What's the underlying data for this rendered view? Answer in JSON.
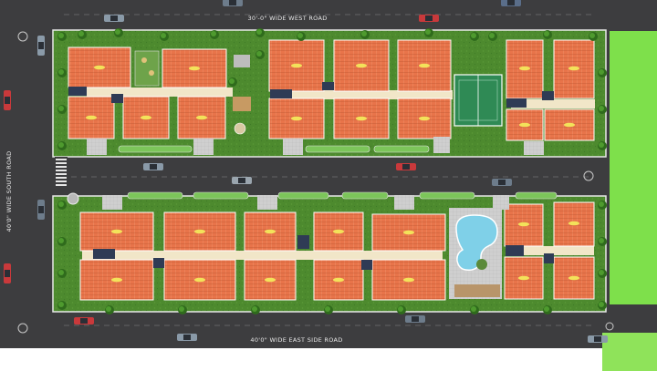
{
  "roads": {
    "north": "30'-0\" WIDE WEST ROAD",
    "west": "40'0\" WIDE SOUTH ROAD",
    "south": "40'0\" WIDE EAST SIDE ROAD"
  },
  "colors": {
    "asphalt": "#3d3d3f",
    "lawn": "#4d8a2e",
    "lawn_dark": "#3a6f22",
    "roof": "#e8744a",
    "roof_tile": "#f0936c",
    "roof_label": "#f3e25a",
    "courtyard": "#d7a97b",
    "boundary_green": "#7ee04b",
    "sport_court": "#2f8a55",
    "pool_water": "#7fd0e8",
    "pool_deck": "#d9d9d9"
  },
  "legend_icons": [
    "tree-icon",
    "car-icon",
    "pool-icon",
    "court-icon",
    "playground-icon"
  ]
}
